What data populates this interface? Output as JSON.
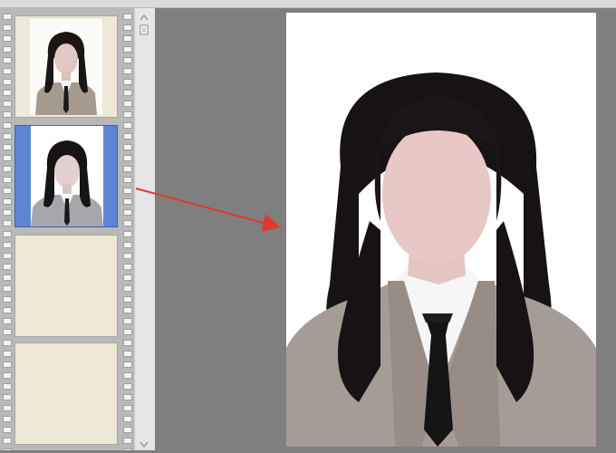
{
  "window": {
    "title": ""
  },
  "filmstrip": {
    "frames": [
      {
        "state": "thumbnail",
        "background": "beige",
        "selected": false
      },
      {
        "state": "thumbnail",
        "background": "blue",
        "selected": true
      },
      {
        "state": "empty",
        "selected": false
      },
      {
        "state": "empty",
        "selected": false
      }
    ]
  },
  "scrollbar": {
    "up_icon": "chevron-up-icon",
    "page_icon": "document-icon",
    "down_icon": "chevron-down-icon"
  },
  "preview": {
    "photo": "id-photo-woman-suit-tie",
    "background": "#ffffff"
  },
  "annotation": {
    "arrow_color": "#e03a2e"
  },
  "colors": {
    "workspace": "#7f7f7f",
    "filmstrip": "#b9b9b9",
    "frame_empty": "#eee8d6",
    "frame_selected": "#5b86d6"
  }
}
